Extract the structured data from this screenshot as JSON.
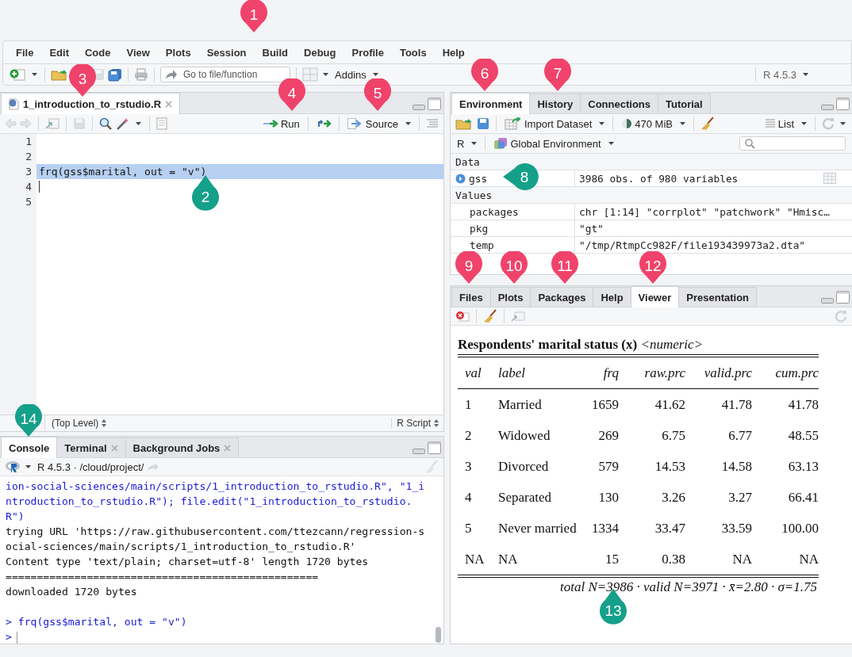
{
  "menu": [
    "File",
    "Edit",
    "Code",
    "View",
    "Plots",
    "Session",
    "Build",
    "Debug",
    "Profile",
    "Tools",
    "Help"
  ],
  "toolbar": {
    "goto_placeholder": "Go to file/function",
    "addins": "Addins",
    "r_version": "R 4.5.3"
  },
  "source": {
    "tab": {
      "label": "1_introduction_to_rstudio.R",
      "selected": true
    },
    "run": "Run",
    "source": "Source",
    "lines": [
      {
        "number": "1",
        "selected": false,
        "cursor": false
      },
      {
        "number": "2",
        "selected": false,
        "cursor": false
      },
      {
        "number": "3",
        "code": "frq(gss$marital, out = \"v\")",
        "selected": true,
        "cursor": false
      },
      {
        "number": "4",
        "selected": false,
        "cursor": true
      },
      {
        "number": "5",
        "selected": false,
        "cursor": false
      }
    ],
    "scope": "(Top Level)",
    "file_type": "R Script"
  },
  "console": {
    "tabs": [
      {
        "label": "Console",
        "selected": true,
        "closable": false
      },
      {
        "label": "Terminal",
        "selected": false,
        "closable": true
      },
      {
        "label": "Background Jobs",
        "selected": false,
        "closable": true
      }
    ],
    "info": "R 4.5.3 · /cloud/project/",
    "lines": [
      {
        "kind": "continued",
        "text": "ion-social-sciences/main/scripts/1_introduction_to_rstudio.R\", \"1_i"
      },
      {
        "kind": "continued",
        "text": "ntroduction_to_rstudio.R\"); file.edit(\"1_introduction_to_rstudio."
      },
      {
        "kind": "continued",
        "text": "R\")"
      },
      {
        "kind": "output",
        "text": "trying URL 'https://raw.githubusercontent.com/ttezcann/regression-s"
      },
      {
        "kind": "output",
        "text": "ocial-sciences/main/scripts/1_introduction_to_rstudio.R'"
      },
      {
        "kind": "output",
        "text": "Content type 'text/plain; charset=utf-8' length 1720 bytes"
      },
      {
        "kind": "output",
        "text": "=================================================="
      },
      {
        "kind": "output",
        "text": "downloaded 1720 bytes"
      },
      {
        "kind": "prompt",
        "text": "> frq(gss$marital, out = \"v\")"
      },
      {
        "kind": "prompt",
        "text": ">",
        "cursor": true
      }
    ]
  },
  "environment": {
    "tabs": [
      {
        "label": "Environment",
        "selected": true
      },
      {
        "label": "History",
        "selected": false
      },
      {
        "label": "Connections",
        "selected": false
      },
      {
        "label": "Tutorial",
        "selected": false
      }
    ],
    "import": "Import Dataset",
    "memory": "470 MiB",
    "view": "List",
    "language": "R",
    "scope": "Global Environment",
    "sections": [
      {
        "title": "Data",
        "rows": [
          {
            "kind": "data",
            "name": "gss",
            "value": "3986 obs. of 980 variables"
          }
        ]
      },
      {
        "title": "Values",
        "rows": [
          {
            "kind": "value",
            "name": "packages",
            "value": "chr [1:14] \"corrplot\" \"patchwork\" \"Hmisc…"
          },
          {
            "kind": "value",
            "name": "pkg",
            "value": "\"gt\""
          },
          {
            "kind": "value",
            "name": "temp",
            "value": "\"/tmp/RtmpCc982F/file193439973a2.dta\""
          }
        ]
      }
    ]
  },
  "files": {
    "tabs": [
      {
        "label": "Files",
        "selected": false
      },
      {
        "label": "Plots",
        "selected": false
      },
      {
        "label": "Packages",
        "selected": false
      },
      {
        "label": "Help",
        "selected": false
      },
      {
        "label": "Viewer",
        "selected": true
      },
      {
        "label": "Presentation",
        "selected": false
      }
    ],
    "viewer": {
      "title": "**Respondents' marital status (x)** *<numeric>*",
      "columns": [
        "val",
        "label",
        "frq",
        "raw.prc",
        "valid.prc",
        "cum.prc"
      ],
      "rows": [
        [
          "1",
          "Married",
          "1659",
          "41.62",
          "41.78",
          "41.78"
        ],
        [
          "2",
          "Widowed",
          "269",
          "6.75",
          "6.77",
          "48.55"
        ],
        [
          "3",
          "Divorced",
          "579",
          "14.53",
          "14.58",
          "63.13"
        ],
        [
          "4",
          "Separated",
          "130",
          "3.26",
          "3.27",
          "66.41"
        ],
        [
          "5",
          "Never married",
          "1334",
          "33.47",
          "33.59",
          "100.00"
        ],
        [
          "NA",
          "NA",
          "15",
          "0.38",
          "NA",
          "NA"
        ]
      ],
      "footer": "total N=3986 · valid N=3971 · x̄=2.80 · σ=1.75"
    }
  },
  "callouts": [
    {
      "label": "1",
      "color": "#f0436b"
    },
    {
      "label": "2",
      "color": "#15a08a"
    },
    {
      "label": "3",
      "color": "#f0436b"
    },
    {
      "label": "4",
      "color": "#f0436b"
    },
    {
      "label": "5",
      "color": "#f0436b"
    },
    {
      "label": "6",
      "color": "#f0436b"
    },
    {
      "label": "7",
      "color": "#f0436b"
    },
    {
      "label": "8",
      "color": "#15a08a"
    },
    {
      "label": "9",
      "color": "#f0436b"
    },
    {
      "label": "10",
      "color": "#f0436b"
    },
    {
      "label": "11",
      "color": "#f0436b"
    },
    {
      "label": "12",
      "color": "#f0436b"
    },
    {
      "label": "13",
      "color": "#15a08a"
    },
    {
      "label": "14",
      "color": "#15a08a"
    }
  ]
}
